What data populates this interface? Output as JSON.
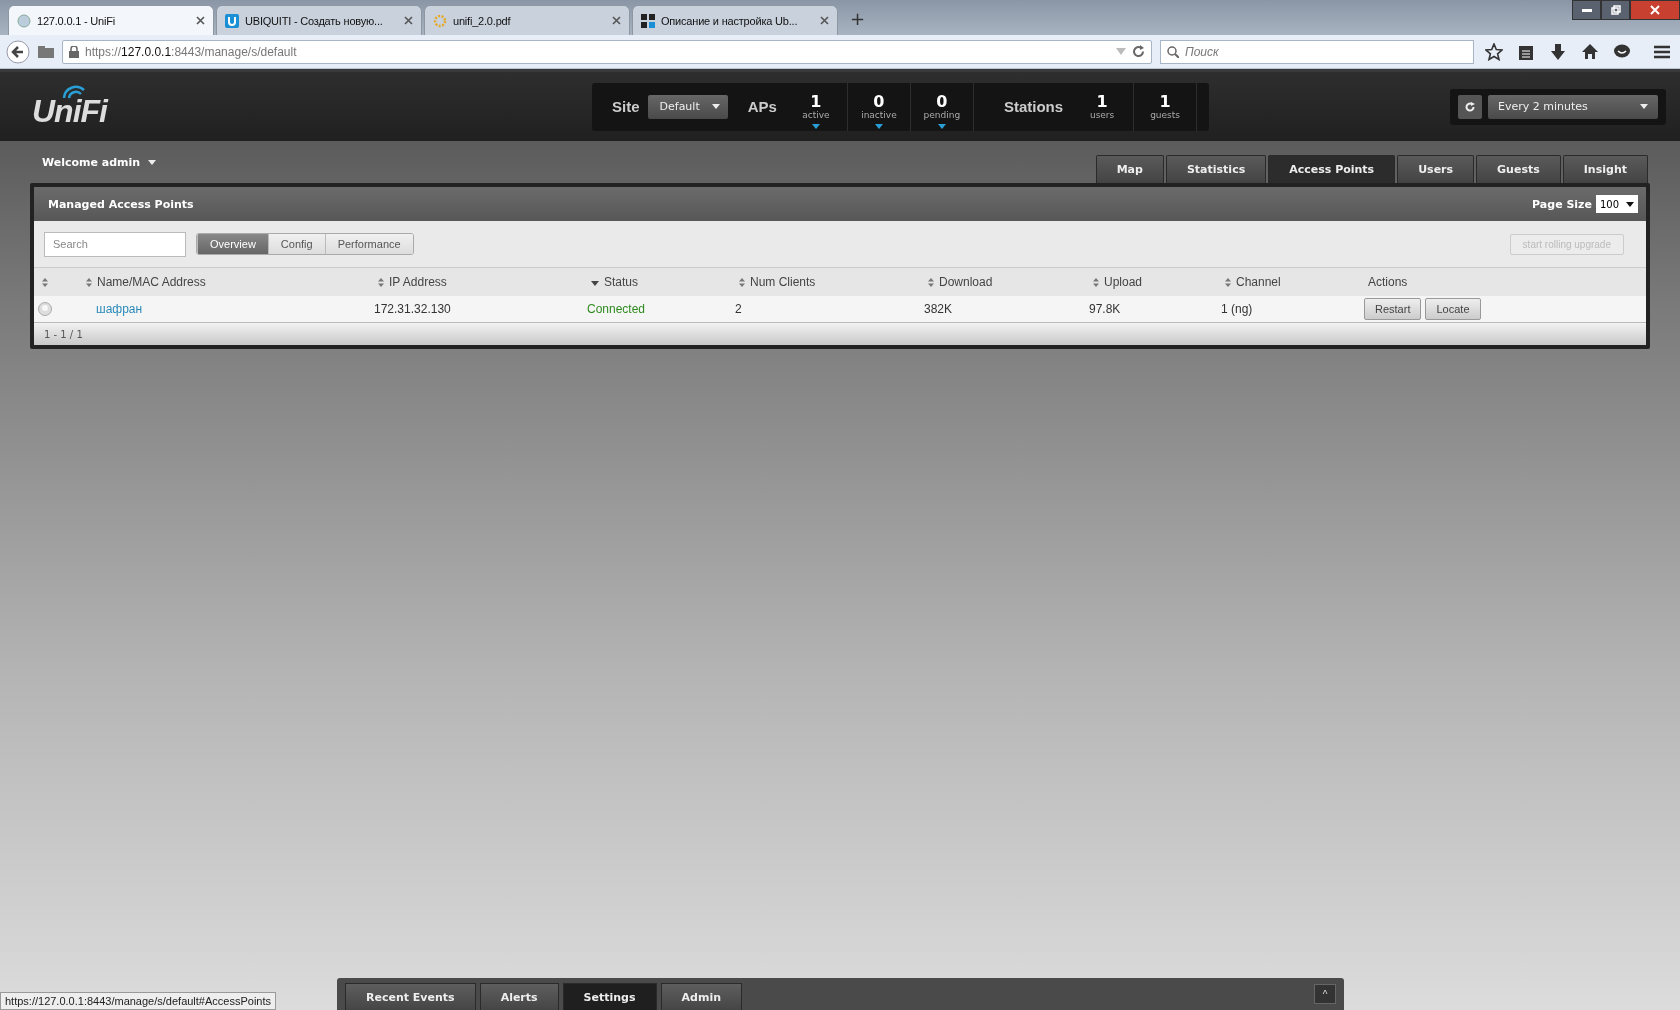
{
  "browser": {
    "tabs": [
      {
        "title": "127.0.0.1 - UniFi",
        "selected": true,
        "kind": "unifi"
      },
      {
        "title": "UBIQUITI - Создать новую...",
        "selected": false,
        "kind": "ubnt"
      },
      {
        "title": "unifi_2.0.pdf",
        "selected": false,
        "kind": "pdf"
      },
      {
        "title": "Описание и настройка Ub...",
        "selected": false,
        "kind": "win"
      }
    ],
    "new_tab": "+",
    "url": {
      "scheme": "https://",
      "host": "127.0.0.1",
      "path": ":8443/manage/s/default"
    },
    "search_placeholder": "Поиск",
    "status_link": "https://127.0.0.1:8443/manage/s/default#AccessPoints"
  },
  "app": {
    "logo": "UniFi",
    "site": {
      "label": "Site",
      "value": "Default"
    },
    "aps": {
      "label": "APs",
      "counts": [
        {
          "value": "1",
          "label": "active"
        },
        {
          "value": "0",
          "label": "inactive"
        },
        {
          "value": "0",
          "label": "pending"
        }
      ]
    },
    "stations": {
      "label": "Stations",
      "counts": [
        {
          "value": "1",
          "label": "users"
        },
        {
          "value": "1",
          "label": "guests"
        }
      ]
    },
    "refresh": {
      "value": "Every 2 minutes"
    },
    "welcome": "Welcome admin",
    "tabs": [
      {
        "label": "Map",
        "selected": false
      },
      {
        "label": "Statistics",
        "selected": false
      },
      {
        "label": "Access Points",
        "selected": true
      },
      {
        "label": "Users",
        "selected": false
      },
      {
        "label": "Guests",
        "selected": false
      },
      {
        "label": "Insight",
        "selected": false
      }
    ],
    "panel": {
      "title": "Managed Access Points",
      "page_size_label": "Page Size",
      "page_size": "100",
      "search_placeholder": "Search",
      "views": [
        {
          "label": "Overview",
          "selected": true
        },
        {
          "label": "Config",
          "selected": false
        },
        {
          "label": "Performance",
          "selected": false
        }
      ],
      "rolling_upgrade": {
        "label": "start rolling upgrade",
        "disabled": true
      },
      "columns": [
        {
          "sortable": true,
          "sorted": false
        },
        {
          "label": "Name/MAC Address",
          "sortable": true,
          "sorted": false
        },
        {
          "label": "IP Address",
          "sortable": true,
          "sorted": false
        },
        {
          "label": "Status",
          "sortable": true,
          "sorted": true
        },
        {
          "label": "Num Clients",
          "sortable": true,
          "sorted": false
        },
        {
          "label": "Download",
          "sortable": true,
          "sorted": false
        },
        {
          "label": "Upload",
          "sortable": true,
          "sorted": false
        },
        {
          "label": "Channel",
          "sortable": true,
          "sorted": false
        },
        {
          "label": "Actions"
        }
      ],
      "rows": [
        {
          "name": "шафран",
          "ip": "172.31.32.130",
          "status": "Connected",
          "clients": "2",
          "download": "382K",
          "upload": "97.8K",
          "channel": "1 (ng)",
          "actions": [
            "Restart",
            "Locate"
          ]
        }
      ],
      "pager": "1 - 1 / 1"
    },
    "bottom_tabs": [
      {
        "label": "Recent Events",
        "selected": false
      },
      {
        "label": "Alerts",
        "selected": false
      },
      {
        "label": "Settings",
        "selected": true
      },
      {
        "label": "Admin",
        "selected": false
      }
    ],
    "collapse": "^"
  }
}
